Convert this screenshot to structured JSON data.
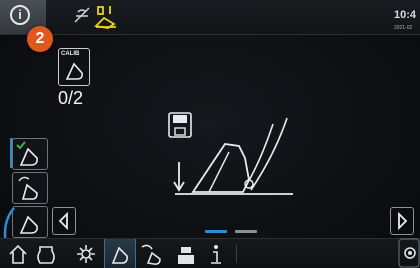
{
  "status": {
    "badge_count": "2",
    "clock_time": "10:4",
    "clock_date": "2021-02"
  },
  "calibration": {
    "tag": "CALIB",
    "count": "0/2"
  },
  "pager": {
    "active_page": 1,
    "page_count": 2
  },
  "icons": {
    "info": "info-icon",
    "machine_status": "machine-lift-icon",
    "save": "floppy-disk-icon",
    "home": "home-icon",
    "tool": "pump-icon",
    "settings": "gear-icon"
  },
  "colors": {
    "accent_blue": "#2a8fd0",
    "badge_orange": "#e2571e",
    "warning_yellow": "#e8d31a",
    "active_green": "#39b54a"
  }
}
